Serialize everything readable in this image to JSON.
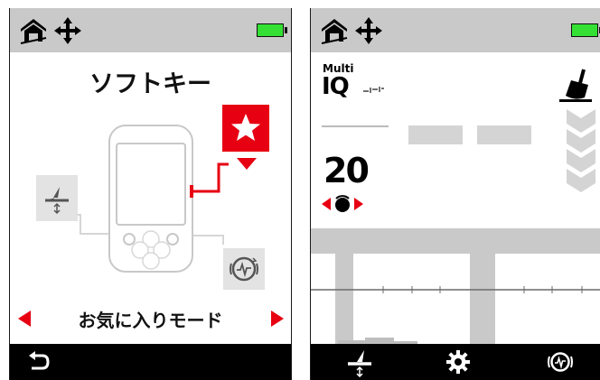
{
  "left_screen": {
    "title": "ソフトキー",
    "mode_label": "お気に入りモード",
    "icons": {
      "home": "home-icon",
      "move": "move-arrows-icon",
      "battery": "battery-icon",
      "star": "star-icon",
      "ground_balance": "ground-balance-icon",
      "noise_cancel": "noise-cancel-icon",
      "back": "back-arrow-icon"
    }
  },
  "right_screen": {
    "multi_label": "Multi",
    "iq_label": "IQ",
    "sensitivity_value": "20",
    "icons": {
      "dig": "dig-shovel-icon",
      "settings": "gear-icon",
      "ground_balance": "ground-balance-icon",
      "noise_cancel": "noise-cancel-icon"
    }
  },
  "colors": {
    "accent_red": "#e60012",
    "battery_green": "#34e034",
    "bar_gray": "#c9c9c9"
  }
}
